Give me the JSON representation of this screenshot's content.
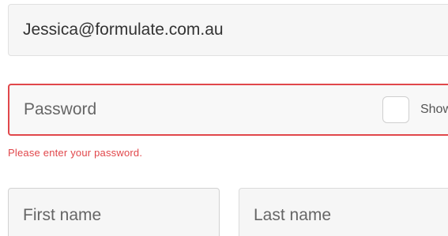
{
  "form": {
    "email": {
      "value": "Jessica@formulate.com.au"
    },
    "password": {
      "placeholder": "Password",
      "show_label": "Show",
      "error": "Please enter your password.",
      "show_checked": false
    },
    "first_name": {
      "placeholder": "First name"
    },
    "last_name": {
      "placeholder": "Last name"
    }
  },
  "colors": {
    "error": "#e1474b",
    "field_background": "#f6f6f6",
    "field_border": "#e1e1e1"
  }
}
